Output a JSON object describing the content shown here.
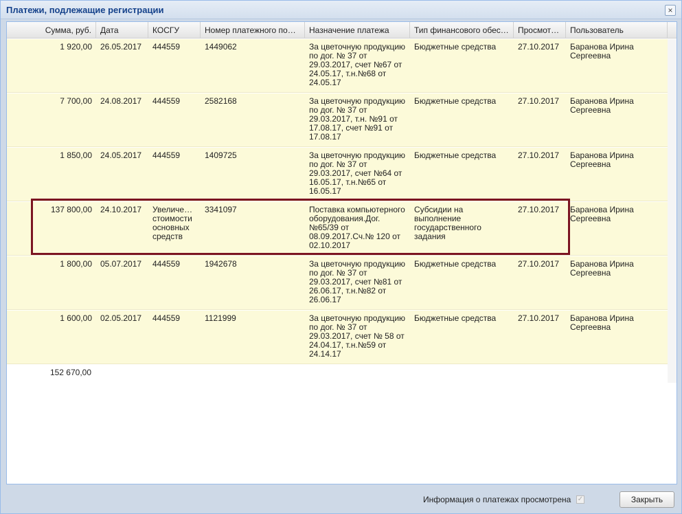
{
  "window": {
    "title": "Платежи, подлежащие регистрации",
    "close_icon": "×"
  },
  "columns": [
    "Сумма, руб.",
    "Дата",
    "КОСГУ",
    "Номер платежного пор…",
    "Назначение платежа",
    "Тип финансового обес…",
    "Просмот…",
    "Пользователь"
  ],
  "rows": [
    {
      "sum": "1 920,00",
      "date": "26.05.2017",
      "kosgu": "444559",
      "number": "1449062",
      "purpose": "За цветочную продукцию по дог. № 37 от 29.03.2017, счет №67 от 24.05.17, т.н.№68 от 24.05.17",
      "fin_type": "Бюджетные средства",
      "viewed": "27.10.2017",
      "user": "Баранова Ирина Сергеевна"
    },
    {
      "sum": "7 700,00",
      "date": "24.08.2017",
      "kosgu": "444559",
      "number": "2582168",
      "purpose": "За цветочную продукцию по дог. № 37 от 29.03.2017, т.н. №91 от 17.08.17, счет №91 от 17.08.17",
      "fin_type": "Бюджетные средства",
      "viewed": "27.10.2017",
      "user": "Баранова Ирина Сергеевна"
    },
    {
      "sum": "1 850,00",
      "date": "24.05.2017",
      "kosgu": "444559",
      "number": "1409725",
      "purpose": "За цветочную продукцию по дог. № 37 от 29.03.2017, счет №64 от 16.05.17, т.н.№65 от 16.05.17",
      "fin_type": "Бюджетные средства",
      "viewed": "27.10.2017",
      "user": "Баранова Ирина Сергеевна"
    },
    {
      "sum": "137 800,00",
      "date": "24.10.2017",
      "kosgu": "Увеличе… стоимости основных средств",
      "number": "3341097",
      "purpose": "Поставка компьютерного оборудования.Дог. №65/39 от 08.09.2017.Сч.№ 120 от 02.10.2017",
      "fin_type": "Субсидии на выполнение государственного задания",
      "viewed": "27.10.2017",
      "user": "Баранова Ирина Сергеевна"
    },
    {
      "sum": "1 800,00",
      "date": "05.07.2017",
      "kosgu": "444559",
      "number": "1942678",
      "purpose": "За цветочную продукцию по дог. № 37 от 29.03.2017, счет №81 от 26.06.17, т.н.№82 от 26.06.17",
      "fin_type": "Бюджетные средства",
      "viewed": "27.10.2017",
      "user": "Баранова Ирина Сергеевна"
    },
    {
      "sum": "1 600,00",
      "date": "02.05.2017",
      "kosgu": "444559",
      "number": "1121999",
      "purpose": "За цветочную продукцию по дог. № 37 от 29.03.2017, счет № 58 от 24.04.17, т.н.№59 от 24.14.17",
      "fin_type": "Бюджетные средства",
      "viewed": "27.10.2017",
      "user": "Баранова Ирина Сергеевна"
    }
  ],
  "total": "152 670,00",
  "footer": {
    "info_label": "Информация о платежах просмотрена",
    "close_button": "Закрыть"
  },
  "colors": {
    "row_bg": "#fcfad9",
    "highlight": "#7b1422",
    "title_text": "#15428b"
  }
}
